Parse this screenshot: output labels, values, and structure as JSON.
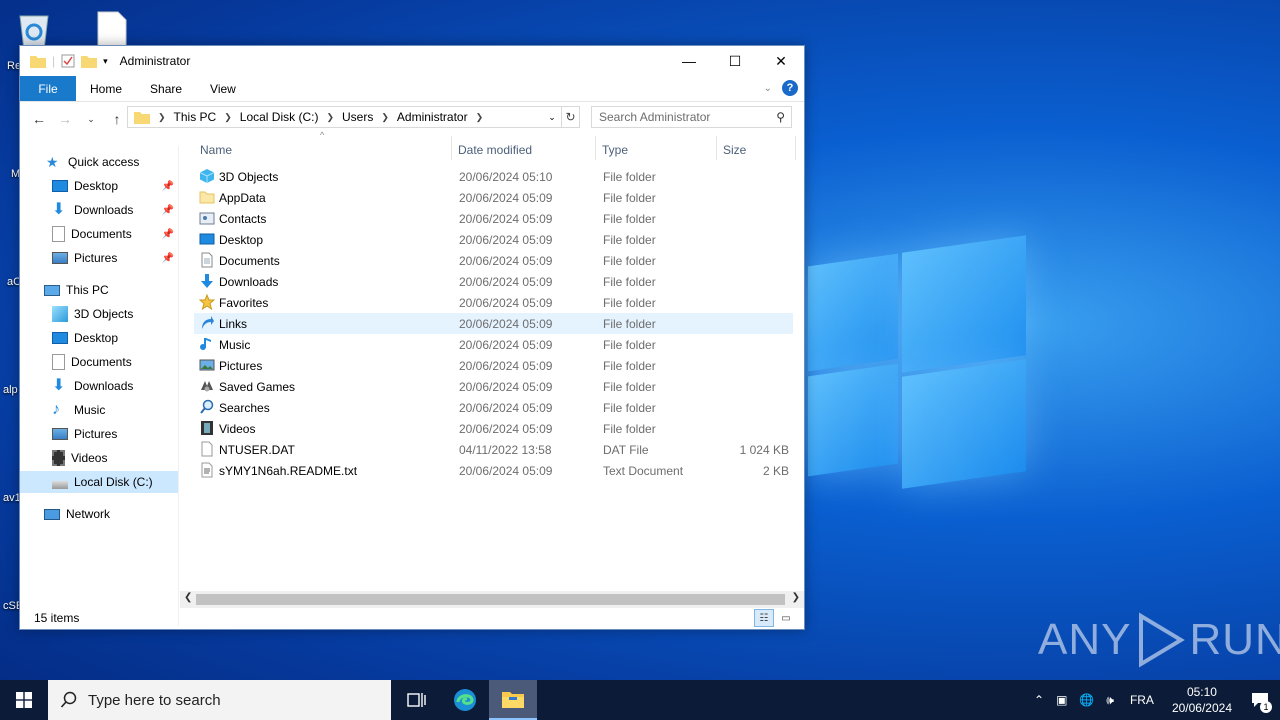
{
  "desktop": {
    "icon_labels": [
      "Re",
      "M",
      "aC",
      "alp",
      "av1",
      "cSE"
    ]
  },
  "window": {
    "title": "Administrator",
    "controls": {
      "minimize": "—",
      "maximize": "☐",
      "close": "✕"
    }
  },
  "ribbon": {
    "tabs": [
      "File",
      "Home",
      "Share",
      "View"
    ]
  },
  "address": {
    "crumbs": [
      "This PC",
      "Local Disk (C:)",
      "Users",
      "Administrator"
    ]
  },
  "search": {
    "placeholder": "Search Administrator"
  },
  "navpane": {
    "quick_access": "Quick access",
    "quick_items": [
      "Desktop",
      "Downloads",
      "Documents",
      "Pictures"
    ],
    "this_pc": "This PC",
    "pc_items": [
      "3D Objects",
      "Desktop",
      "Documents",
      "Downloads",
      "Music",
      "Pictures",
      "Videos",
      "Local Disk (C:)"
    ],
    "network": "Network"
  },
  "columns": {
    "name": "Name",
    "date": "Date modified",
    "type": "Type",
    "size": "Size"
  },
  "files": [
    {
      "name": "3D Objects",
      "date": "20/06/2024 05:10",
      "type": "File folder",
      "size": "",
      "icon": "3d-objects-icon"
    },
    {
      "name": "AppData",
      "date": "20/06/2024 05:09",
      "type": "File folder",
      "size": "",
      "icon": "folder-icon"
    },
    {
      "name": "Contacts",
      "date": "20/06/2024 05:09",
      "type": "File folder",
      "size": "",
      "icon": "contacts-icon"
    },
    {
      "name": "Desktop",
      "date": "20/06/2024 05:09",
      "type": "File folder",
      "size": "",
      "icon": "desktop-icon"
    },
    {
      "name": "Documents",
      "date": "20/06/2024 05:09",
      "type": "File folder",
      "size": "",
      "icon": "documents-icon"
    },
    {
      "name": "Downloads",
      "date": "20/06/2024 05:09",
      "type": "File folder",
      "size": "",
      "icon": "downloads-icon"
    },
    {
      "name": "Favorites",
      "date": "20/06/2024 05:09",
      "type": "File folder",
      "size": "",
      "icon": "favorites-icon"
    },
    {
      "name": "Links",
      "date": "20/06/2024 05:09",
      "type": "File folder",
      "size": "",
      "icon": "links-icon"
    },
    {
      "name": "Music",
      "date": "20/06/2024 05:09",
      "type": "File folder",
      "size": "",
      "icon": "music-icon"
    },
    {
      "name": "Pictures",
      "date": "20/06/2024 05:09",
      "type": "File folder",
      "size": "",
      "icon": "pictures-icon"
    },
    {
      "name": "Saved Games",
      "date": "20/06/2024 05:09",
      "type": "File folder",
      "size": "",
      "icon": "saved-games-icon"
    },
    {
      "name": "Searches",
      "date": "20/06/2024 05:09",
      "type": "File folder",
      "size": "",
      "icon": "searches-icon"
    },
    {
      "name": "Videos",
      "date": "20/06/2024 05:09",
      "type": "File folder",
      "size": "",
      "icon": "videos-icon"
    },
    {
      "name": "NTUSER.DAT",
      "date": "04/11/2022 13:58",
      "type": "DAT File",
      "size": "1 024 KB",
      "icon": "file-icon"
    },
    {
      "name": "sYMY1N6ah.README.txt",
      "date": "20/06/2024 05:09",
      "type": "Text Document",
      "size": "2 KB",
      "icon": "text-file-icon"
    }
  ],
  "status": {
    "count": "15 items"
  },
  "taskbar": {
    "search_placeholder": "Type here to search",
    "lang": "FRA",
    "time": "05:10",
    "date": "20/06/2024",
    "notifications": "1"
  },
  "watermark": {
    "left": "ANY",
    "right": "RUN"
  },
  "colors": {
    "accent": "#1979ca",
    "selection": "#cce8ff",
    "hover": "#e5f3ff",
    "folder": "#f8d775"
  }
}
